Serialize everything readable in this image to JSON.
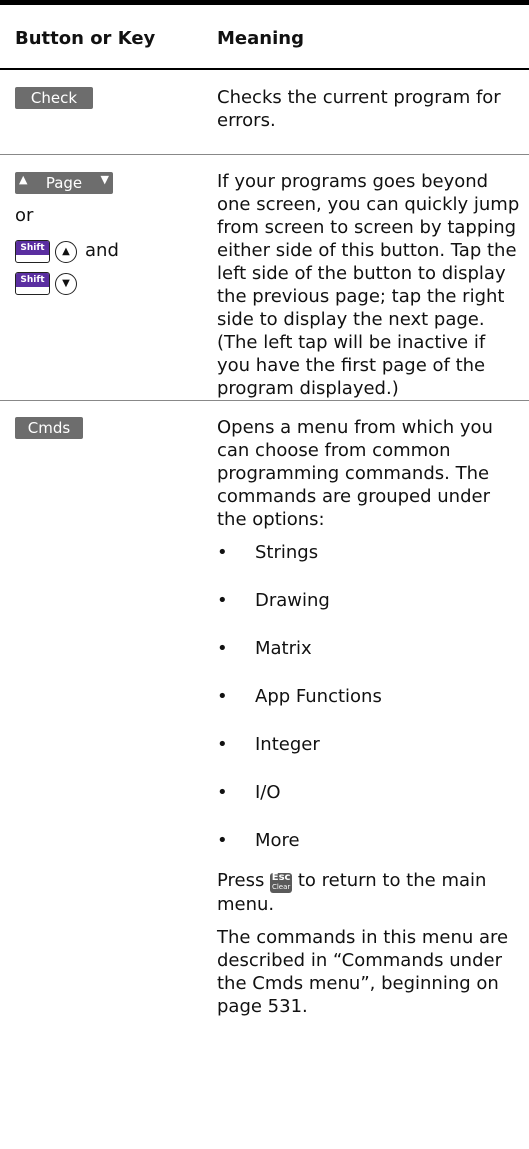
{
  "table": {
    "header": {
      "col1": "Button or Key",
      "col2": "Meaning"
    },
    "rows": [
      {
        "key": {
          "label": "Check"
        },
        "meaning": "Checks the current program for errors."
      },
      {
        "key": {
          "page_label": "Page",
          "or": "or",
          "shift_label": "Shift",
          "and": "and"
        },
        "meaning": "If your programs goes beyond one screen, you can quickly jump from screen to screen by tapping either side of this button. Tap the left side of the button to display the previous page; tap the right side to display the next page. (The left tap will be inactive if you have the first page of the program displayed.)"
      },
      {
        "key": {
          "label": "Cmds"
        },
        "meaning": "Opens a menu from which you can choose from common programming commands. The commands are grouped under the options:",
        "options": [
          "Strings",
          "Drawing",
          "Matrix",
          "App Functions",
          "Integer",
          "I/O",
          "More"
        ],
        "press_prefix": "Press",
        "press_suffix": "to return to the main menu.",
        "esc_key": {
          "top": "Esc",
          "bottom": "Clear"
        },
        "note": "The commands in this menu are described in “Commands under the Cmds menu”, beginning on page 531."
      }
    ]
  },
  "colors": {
    "softkey_bg": "#6d6d6d",
    "shift_purple": "#5a2ea0",
    "rule": "#000000"
  }
}
